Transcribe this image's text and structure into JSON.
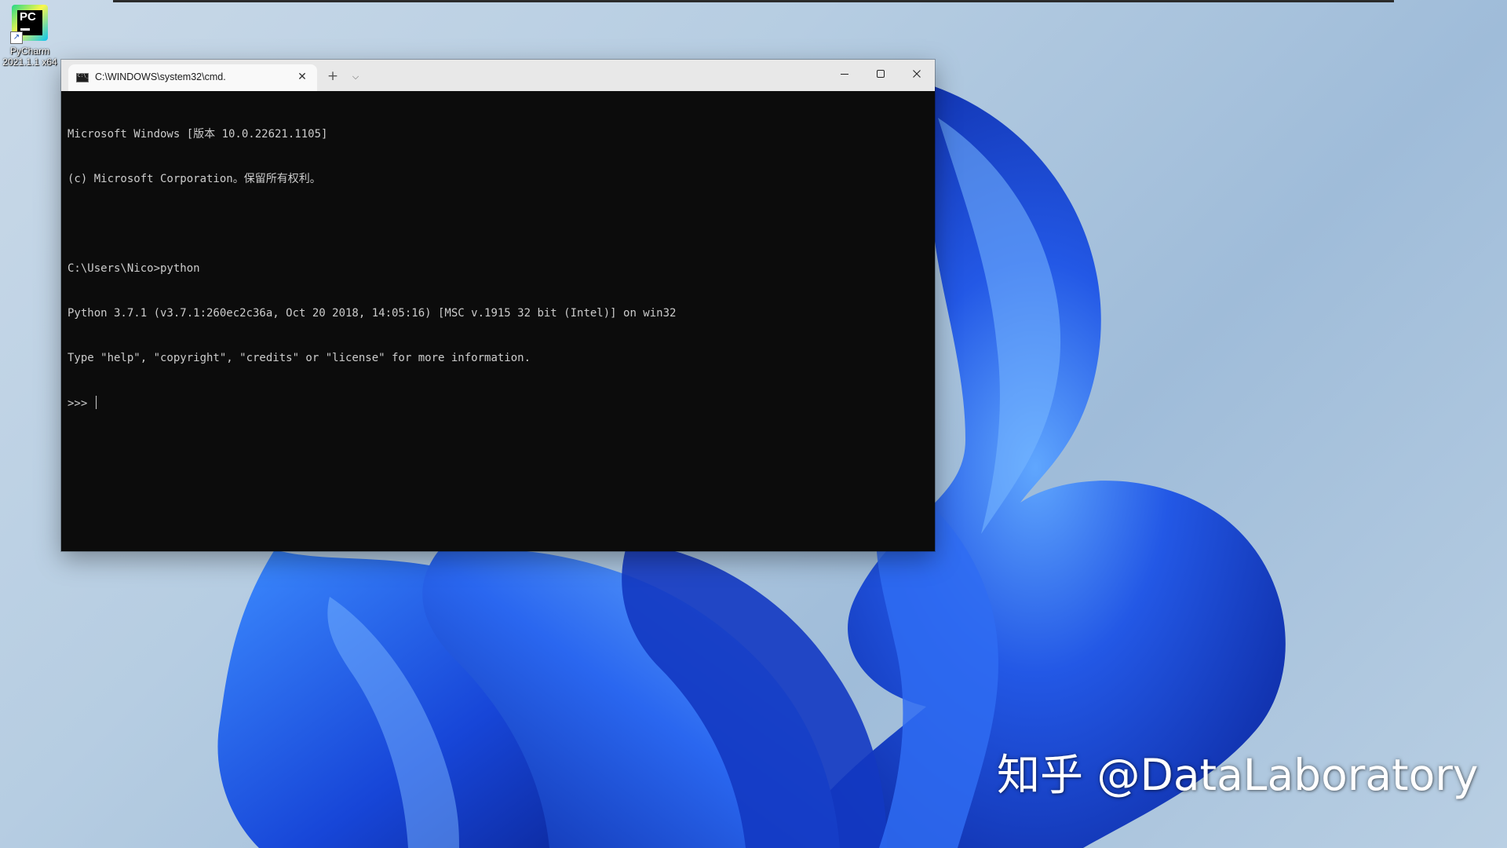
{
  "desktop": {
    "icons": [
      {
        "label_line1": "PyCharm",
        "label_line2": "2021.1.1 x64",
        "logo_text": "PC",
        "shortcut_glyph": "↗"
      }
    ]
  },
  "terminal": {
    "tab": {
      "title": "C:\\WINDOWS\\system32\\cmd.",
      "close_glyph": "✕"
    },
    "new_tab_glyph": "+",
    "dropdown_glyph": "⌵",
    "lines": [
      "Microsoft Windows [版本 10.0.22621.1105]",
      "(c) Microsoft Corporation。保留所有权利。",
      "",
      "C:\\Users\\Nico>python",
      "Python 3.7.1 (v3.7.1:260ec2c36a, Oct 20 2018, 14:05:16) [MSC v.1915 32 bit (Intel)] on win32",
      "Type \"help\", \"copyright\", \"credits\" or \"license\" for more information."
    ],
    "prompt": ">>> "
  },
  "watermark": {
    "text": "知乎 @DataLaboratory"
  },
  "colors": {
    "console_bg": "#0c0c0c",
    "console_fg": "#cccccc",
    "titlebar_bg": "#e8e8e8",
    "tab_bg": "#f9f9f9",
    "wallpaper_blue": "#1f4fe0"
  }
}
